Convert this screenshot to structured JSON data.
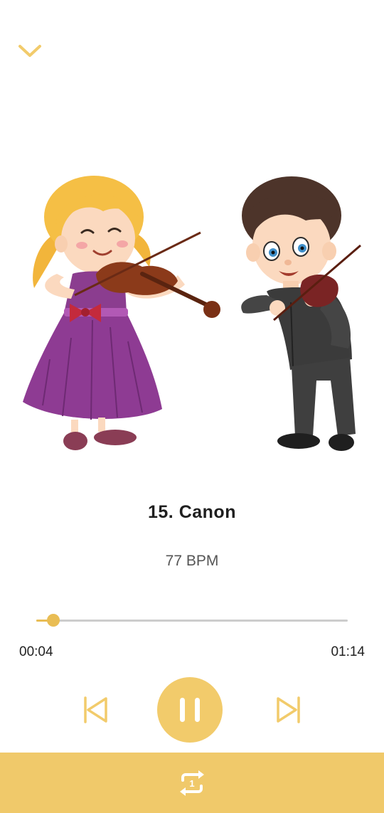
{
  "theme": {
    "accent": "#f2cb6b",
    "accent_dark": "#e9bd54",
    "bar": "#f0c96a"
  },
  "header": {
    "collapse_icon": "chevron-down-icon"
  },
  "track": {
    "title": "15. Canon",
    "bpm": "77 BPM",
    "artwork": "girl-and-boy-playing-violin-illustration"
  },
  "progress": {
    "elapsed": "00:04",
    "total": "01:14",
    "fraction": 0.054
  },
  "controls": {
    "previous_icon": "skip-previous-icon",
    "pause_icon": "pause-icon",
    "next_icon": "skip-next-icon",
    "repeat_icon": "repeat-one-icon",
    "repeat_badge": "1"
  }
}
